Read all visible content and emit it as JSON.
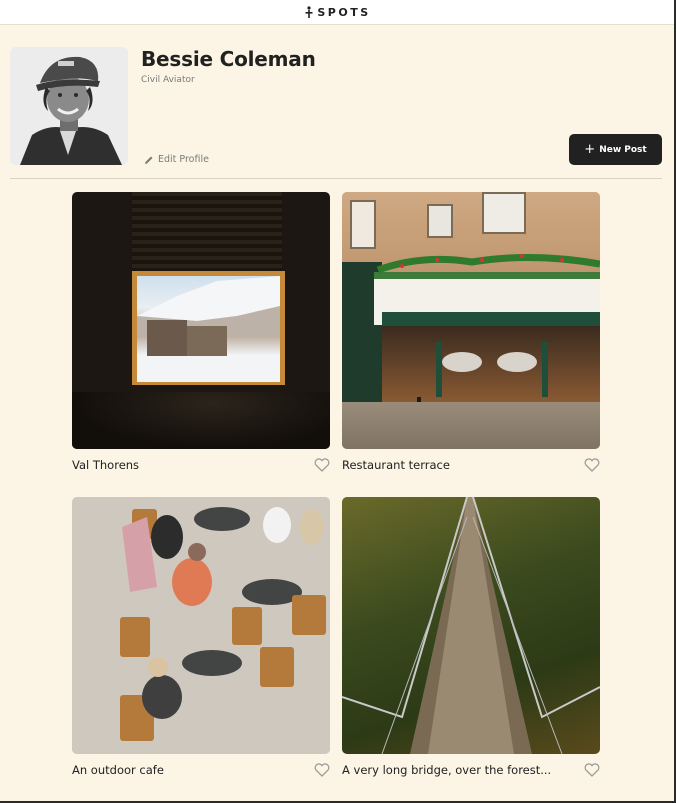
{
  "app": {
    "name": "SPOTS"
  },
  "profile": {
    "name": "Bessie Coleman",
    "caption": "Civil Aviator",
    "edit_label": "Edit Profile",
    "new_post_label": "New Post"
  },
  "cards": [
    {
      "title": "Val Thorens"
    },
    {
      "title": "Restaurant terrace"
    },
    {
      "title": "An outdoor cafe"
    },
    {
      "title": "A very long bridge, over the forest..."
    }
  ],
  "colors": {
    "background": "#fcf5e5",
    "button": "#212121",
    "text": "#212121",
    "muted": "#7a7a7a"
  },
  "icons": [
    "spots-logo-icon",
    "pencil-icon",
    "plus-icon",
    "heart-icon"
  ]
}
